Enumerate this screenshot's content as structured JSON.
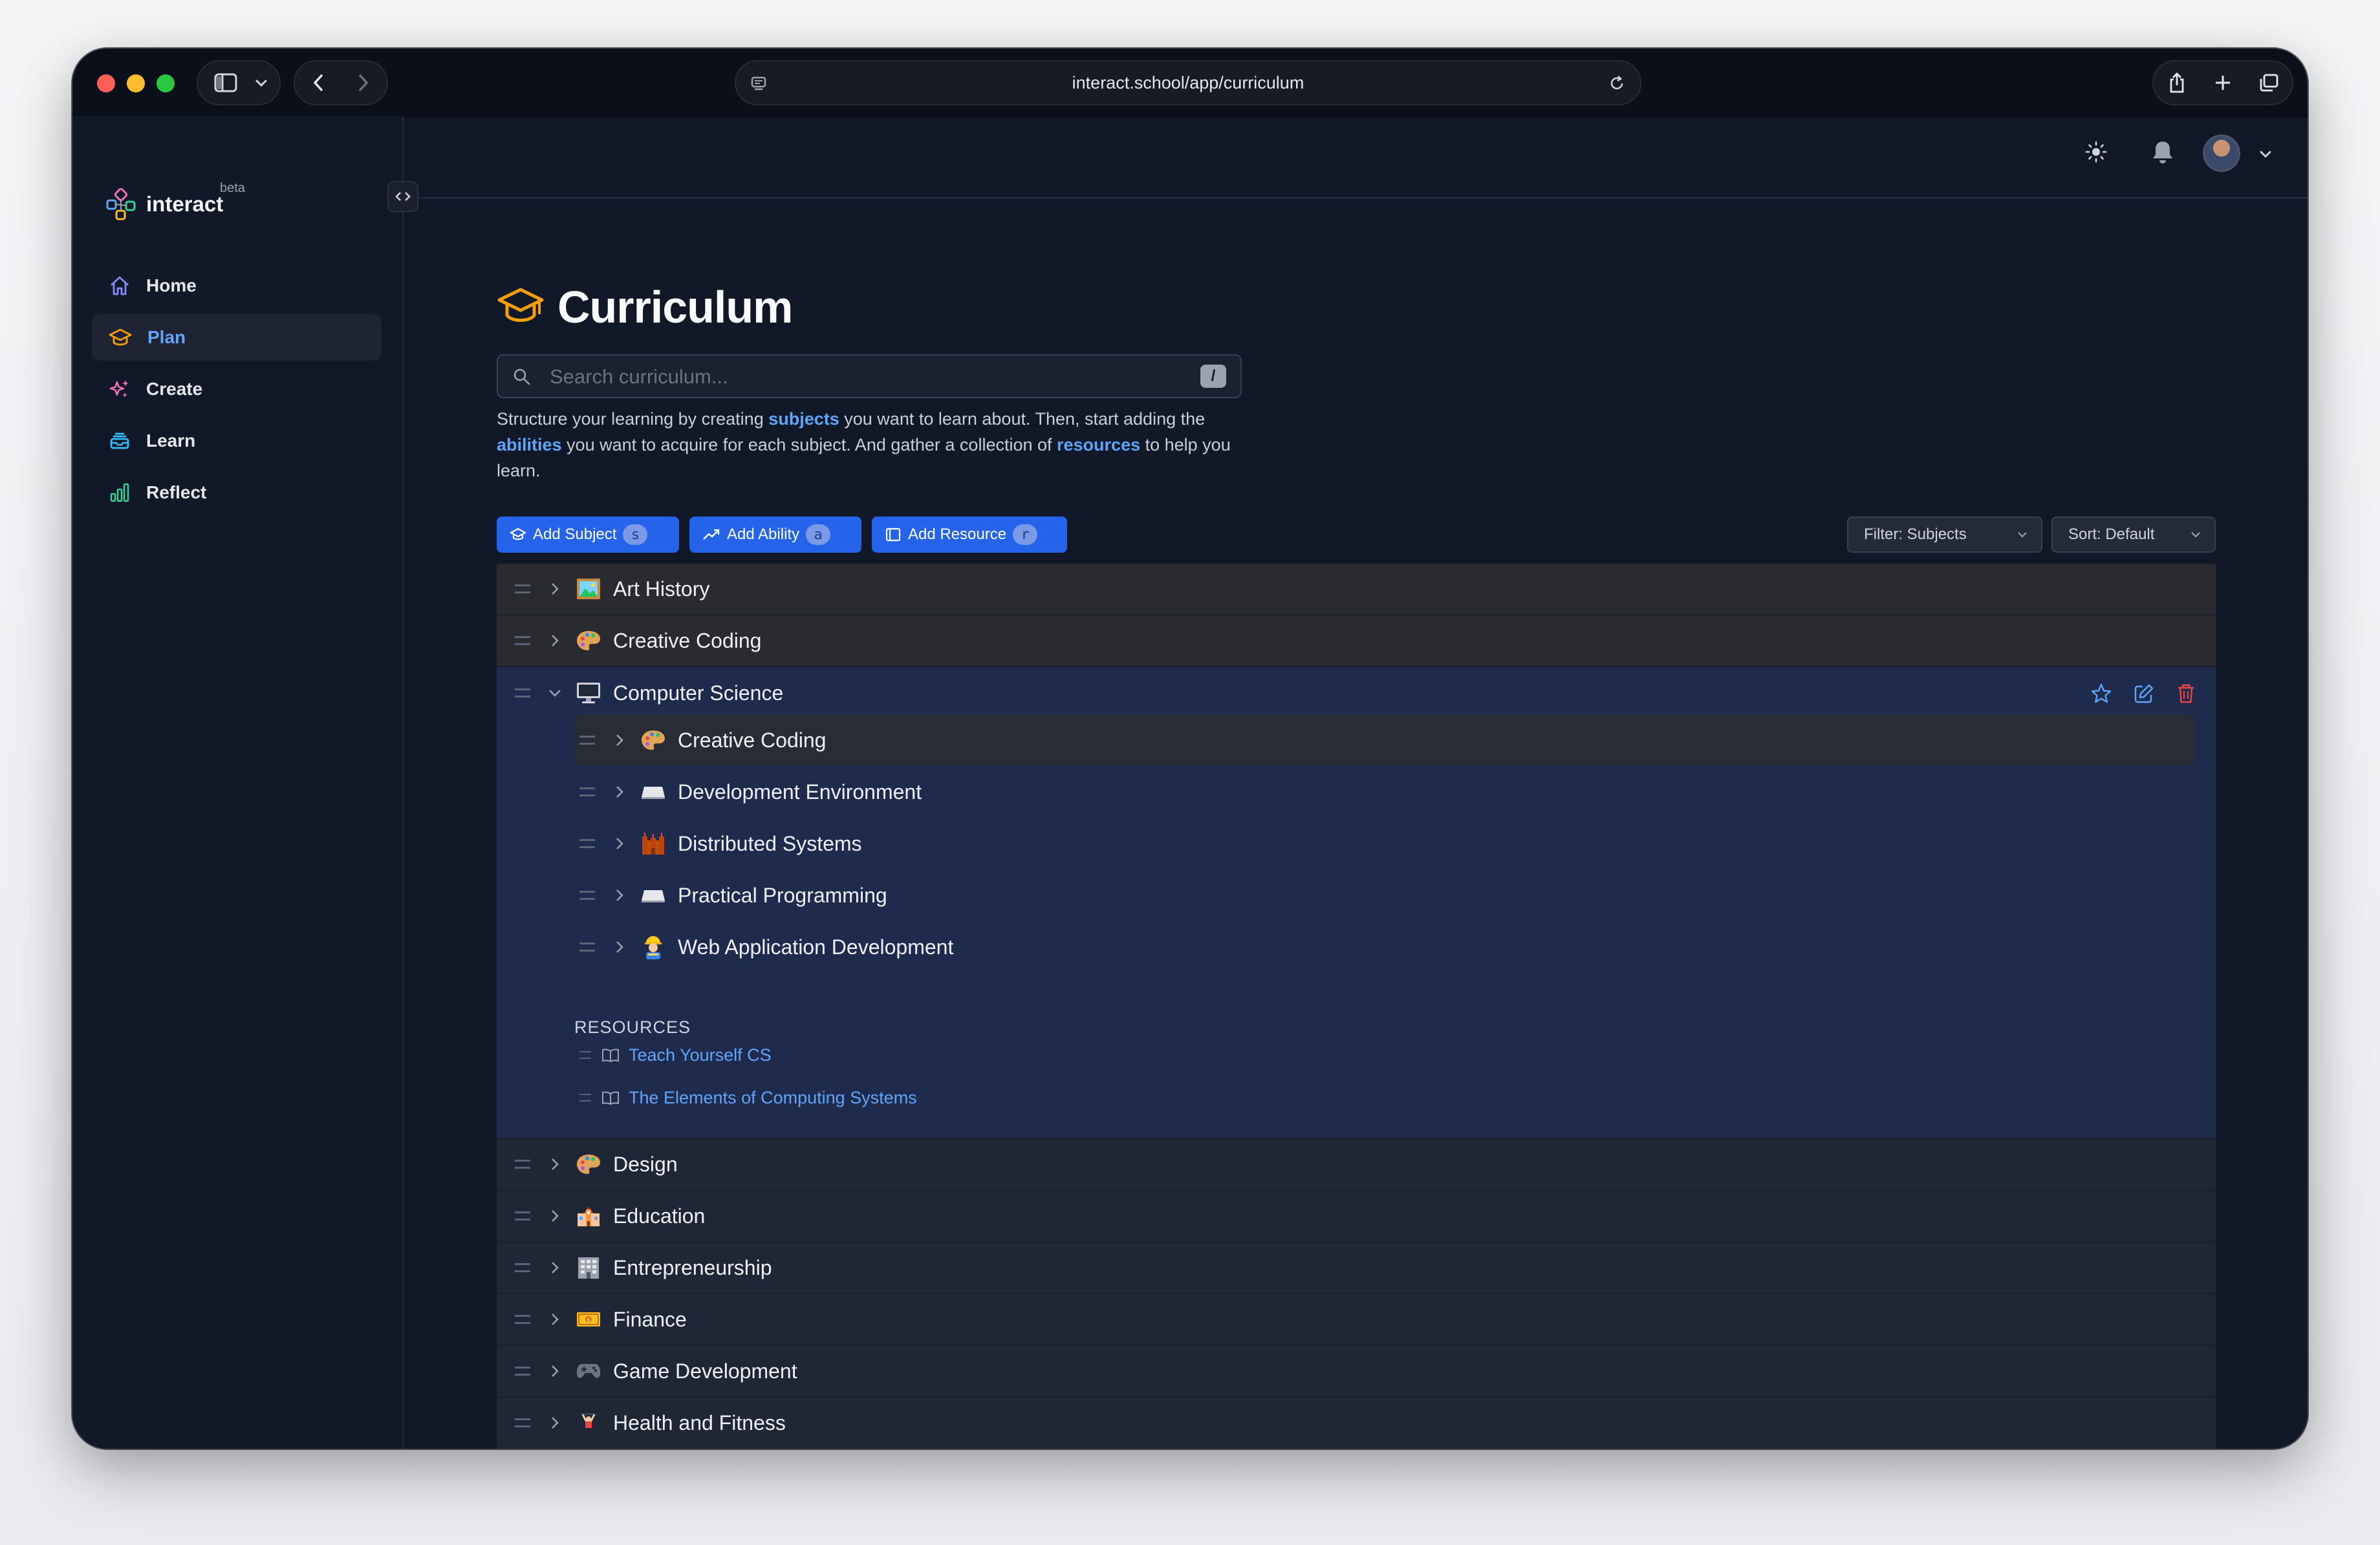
{
  "browser": {
    "url": "interact.school/app/curriculum"
  },
  "sidebar": {
    "logo": "interact",
    "logo_badge": "beta",
    "items": [
      {
        "label": "Home",
        "icon": "home-icon"
      },
      {
        "label": "Plan",
        "icon": "graduation-cap-icon",
        "active": true
      },
      {
        "label": "Create",
        "icon": "sparkles-icon"
      },
      {
        "label": "Learn",
        "icon": "inbox-stack-icon"
      },
      {
        "label": "Reflect",
        "icon": "bar-chart-icon"
      }
    ]
  },
  "page": {
    "title": "Curriculum",
    "search_placeholder": "Search curriculum...",
    "search_shortcut": "/",
    "intro": {
      "p1": "Structure your learning by creating ",
      "subjects": "subjects",
      "p2": " you want to learn about. Then, start adding the ",
      "abilities": "abilities",
      "p3": " you want to acquire for each subject. And gather a collection of ",
      "resources": "resources",
      "p4": " to help you learn."
    },
    "actions": [
      {
        "label": "Add Subject",
        "key": "s"
      },
      {
        "label": "Add Ability",
        "key": "a"
      },
      {
        "label": "Add Resource",
        "key": "r"
      }
    ],
    "filter_label": "Filter: Subjects",
    "sort_label": "Sort: Default"
  },
  "subjects": {
    "before": [
      {
        "label": "Art History",
        "icon": "framed-picture-icon"
      },
      {
        "label": "Creative Coding",
        "icon": "palette-icon"
      }
    ],
    "expanded": {
      "label": "Computer Science",
      "icon": "desktop-computer-icon",
      "children": [
        {
          "label": "Creative Coding",
          "icon": "palette-icon"
        },
        {
          "label": "Development Environment",
          "icon": "keyboard-icon"
        },
        {
          "label": "Distributed Systems",
          "icon": "castle-icon"
        },
        {
          "label": "Practical Programming",
          "icon": "keyboard-icon"
        },
        {
          "label": "Web Application Development",
          "icon": "construction-worker-icon"
        }
      ],
      "resources_title": "RESOURCES",
      "resources": [
        "Teach Yourself CS",
        "The Elements of Computing Systems"
      ]
    },
    "after": [
      {
        "label": "Design",
        "icon": "palette-icon"
      },
      {
        "label": "Education",
        "icon": "school-icon"
      },
      {
        "label": "Entrepreneurship",
        "icon": "office-building-icon"
      },
      {
        "label": "Finance",
        "icon": "banknote-icon"
      },
      {
        "label": "Game Development",
        "icon": "game-controller-icon"
      },
      {
        "label": "Health and Fitness",
        "icon": "weight-lifter-icon"
      }
    ]
  },
  "colors": {
    "accent": "#2563eb",
    "active_nav": "#60a5fa",
    "logo_icon": "#f59e0b"
  }
}
